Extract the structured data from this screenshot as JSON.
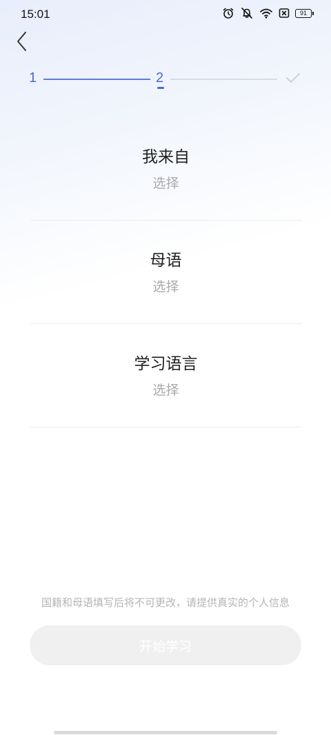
{
  "status_bar": {
    "time": "15:01",
    "battery": "91",
    "icons": [
      "alarm-icon",
      "mute-icon",
      "wifi-icon",
      "sim-none-icon",
      "battery-icon"
    ]
  },
  "nav": {
    "back_icon": "back-chevron-icon"
  },
  "stepper": {
    "step1": "1",
    "step2": "2",
    "done_icon": "check-icon",
    "active_color": "#4a6ad0",
    "inactive_color": "#d6dbe4"
  },
  "fields": {
    "from": {
      "title": "我来自",
      "value": "选择"
    },
    "native_language": {
      "title": "母语",
      "value": "选择"
    },
    "learning_language": {
      "title": "学习语言",
      "value": "选择"
    }
  },
  "notice": "国籍和母语填写后将不可更改，请提供真实的个人信息",
  "start_button": "开始学习"
}
